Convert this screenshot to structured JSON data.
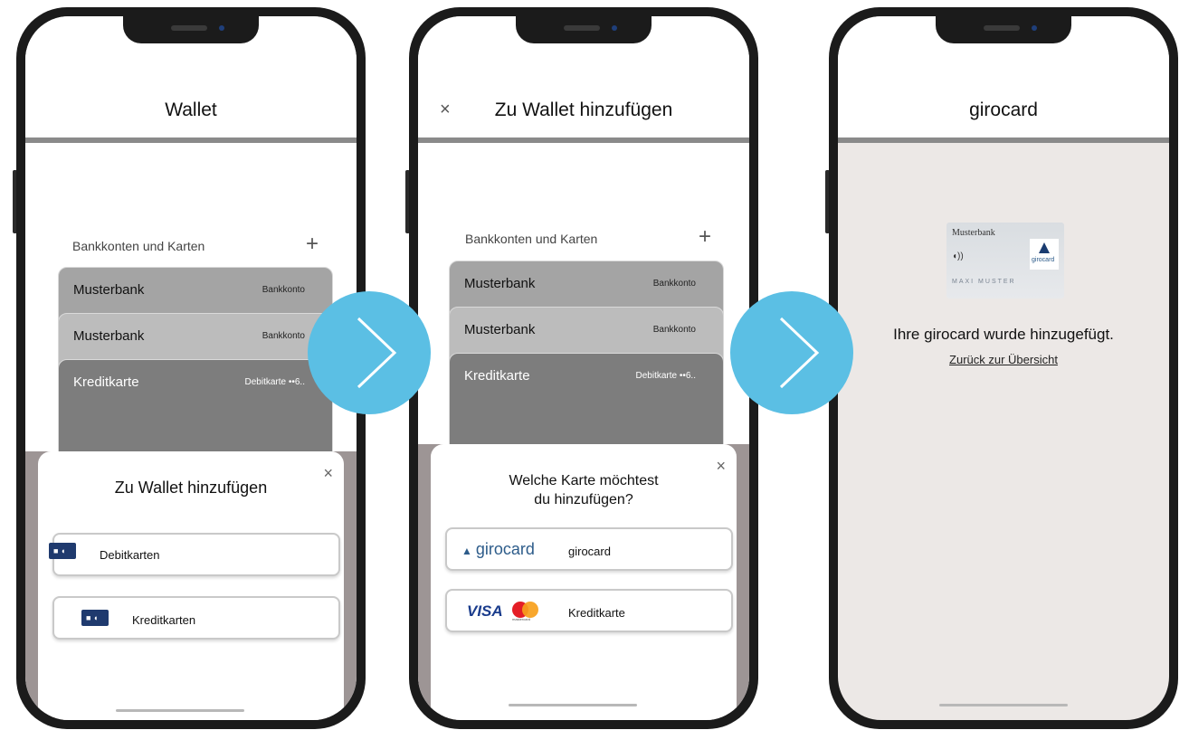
{
  "screen1": {
    "title": "Wallet",
    "section_label": "Bankkonten und Karten",
    "add_symbol": "+",
    "cards": [
      {
        "name": "Musterbank",
        "type": "Bankkonto"
      },
      {
        "name": "Musterbank",
        "type": "Bankkonto"
      },
      {
        "name": "Kreditkarte",
        "type": "Debitkarte ••6.."
      }
    ],
    "sheet": {
      "title": "Zu Wallet hinzufügen",
      "close_symbol": "×",
      "options": [
        {
          "label": "Debitkarten"
        },
        {
          "label": "Kreditkarten"
        }
      ]
    }
  },
  "screen2": {
    "close_symbol": "×",
    "title": "Zu Wallet hinzufügen",
    "section_label": "Bankkonten und Karten",
    "add_symbol": "+",
    "cards": [
      {
        "name": "Musterbank",
        "type": "Bankkonto"
      },
      {
        "name": "Musterbank",
        "type": "Bankkonto"
      },
      {
        "name": "Kreditkarte",
        "type": "Debitkarte ••6.."
      }
    ],
    "sheet": {
      "title_line1": "Welche Karte möchtest",
      "title_line2": "du hinzufügen?",
      "close_symbol": "×",
      "options": [
        {
          "logo_text": "girocard",
          "label": "girocard"
        },
        {
          "logo_visa": "VISA",
          "logo_mc": "mastercard",
          "label": "Kreditkarte"
        }
      ]
    }
  },
  "screen3": {
    "title": "girocard",
    "card": {
      "bank": "Musterbank",
      "holder": "MAXI MUSTER",
      "brand": "girocard"
    },
    "message": "Ihre girocard wurde hinzugefügt.",
    "link": "Zurück zur Übersicht"
  },
  "colors": {
    "arrow": "#5bbfe4",
    "frame": "#1b1b1b",
    "card_dark": "#7d7d7d",
    "card_mid": "#a9a9a9",
    "card_light": "#bdbdbd",
    "overlay": "#9d9595",
    "success_bg": "#ece8e6"
  }
}
